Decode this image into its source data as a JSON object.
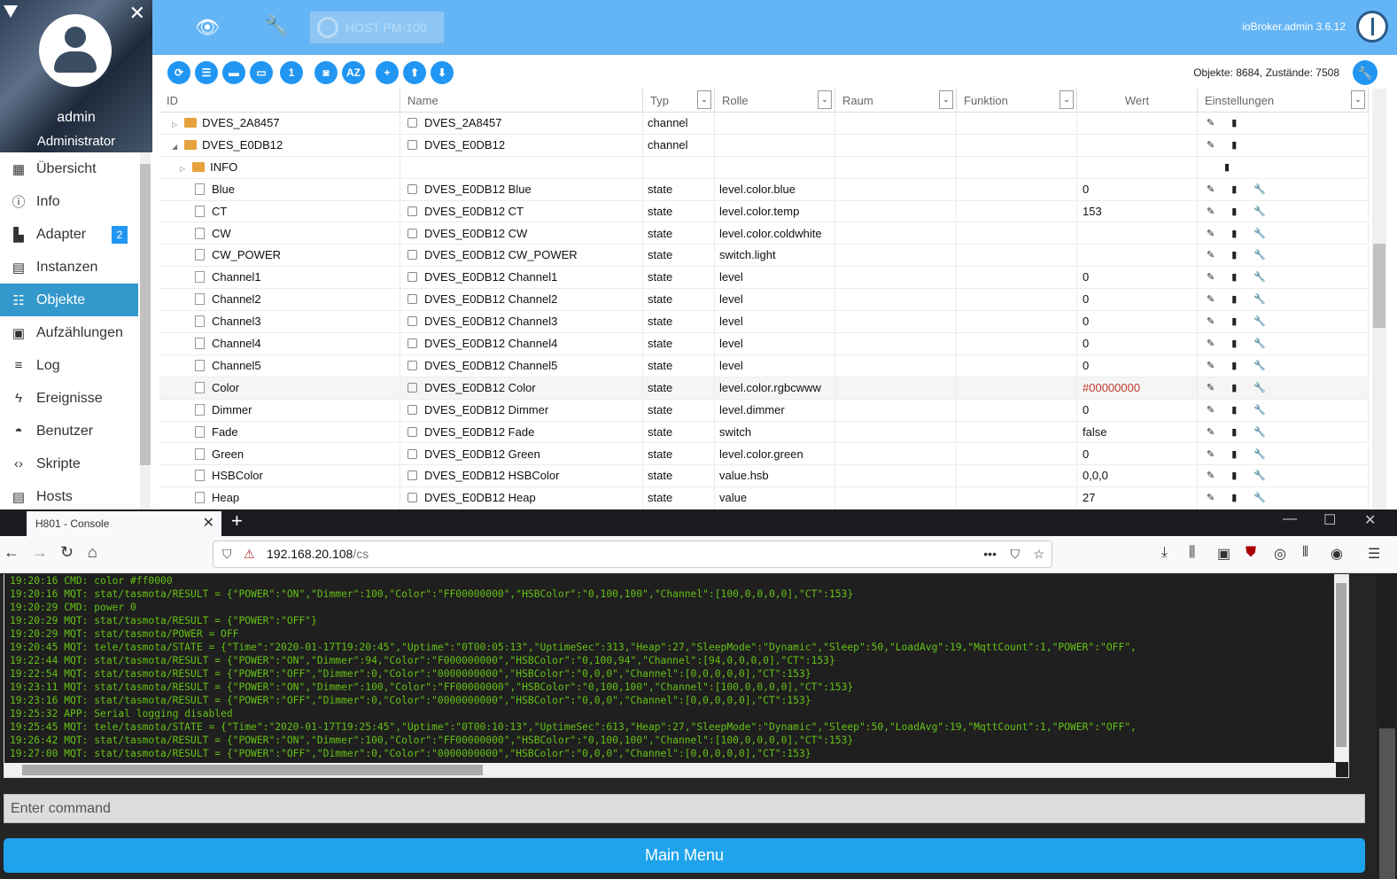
{
  "user": {
    "name": "admin",
    "role": "Administrator"
  },
  "sidebar": {
    "items": [
      {
        "label": "Übersicht",
        "icon": "grid-icon"
      },
      {
        "label": "Info",
        "icon": "info-icon"
      },
      {
        "label": "Adapter",
        "icon": "store-icon",
        "badge": "2"
      },
      {
        "label": "Instanzen",
        "icon": "instances-icon"
      },
      {
        "label": "Objekte",
        "icon": "list-icon",
        "active": true
      },
      {
        "label": "Aufzählungen",
        "icon": "enum-icon"
      },
      {
        "label": "Log",
        "icon": "log-icon"
      },
      {
        "label": "Ereignisse",
        "icon": "lightning-icon"
      },
      {
        "label": "Benutzer",
        "icon": "user-icon"
      },
      {
        "label": "Skripte",
        "icon": "code-icon"
      },
      {
        "label": "Hosts",
        "icon": "hosts-icon"
      }
    ]
  },
  "topbar": {
    "host_label": "HOST PM-100",
    "version": "ioBroker.admin 3.6.12"
  },
  "toolbar": {
    "object_count": "Objekte: 8684, Zustände: 7508"
  },
  "table": {
    "columns": [
      "ID",
      "Name",
      "Typ",
      "Rolle",
      "Raum",
      "Funktion",
      "Wert",
      "Einstellungen"
    ],
    "rows": [
      {
        "id": "DVES_2A8457",
        "kind": "folder",
        "level": 0,
        "expand": "▷",
        "name": "DVES_2A8457",
        "type": "channel",
        "role": "",
        "value": "",
        "actions": "✎ ▮"
      },
      {
        "id": "DVES_E0DB12",
        "kind": "folder",
        "level": 0,
        "expand": "◢",
        "name": "DVES_E0DB12",
        "type": "channel",
        "role": "",
        "value": "",
        "actions": "✎ ▮"
      },
      {
        "id": "INFO",
        "kind": "folder",
        "level": 1,
        "expand": "▷",
        "name": "",
        "type": "",
        "role": "",
        "value": "",
        "actions": "▮"
      },
      {
        "id": "Blue",
        "kind": "file",
        "level": 1,
        "name": "DVES_E0DB12 Blue",
        "type": "state",
        "role": "level.color.blue",
        "value": "0",
        "actions": "✎ ▮ 🔧"
      },
      {
        "id": "CT",
        "kind": "file",
        "level": 1,
        "name": "DVES_E0DB12 CT",
        "type": "state",
        "role": "level.color.temp",
        "value": "153",
        "actions": "✎ ▮ 🔧"
      },
      {
        "id": "CW",
        "kind": "file",
        "level": 1,
        "name": "DVES_E0DB12 CW",
        "type": "state",
        "role": "level.color.coldwhite",
        "value": "",
        "actions": "✎ ▮ 🔧"
      },
      {
        "id": "CW_POWER",
        "kind": "file",
        "level": 1,
        "name": "DVES_E0DB12 CW_POWER",
        "type": "state",
        "role": "switch.light",
        "value": "",
        "actions": "✎ ▮ 🔧"
      },
      {
        "id": "Channel1",
        "kind": "file",
        "level": 1,
        "name": "DVES_E0DB12 Channel1",
        "type": "state",
        "role": "level",
        "value": "0",
        "actions": "✎ ▮ 🔧"
      },
      {
        "id": "Channel2",
        "kind": "file",
        "level": 1,
        "name": "DVES_E0DB12 Channel2",
        "type": "state",
        "role": "level",
        "value": "0",
        "actions": "✎ ▮ 🔧"
      },
      {
        "id": "Channel3",
        "kind": "file",
        "level": 1,
        "name": "DVES_E0DB12 Channel3",
        "type": "state",
        "role": "level",
        "value": "0",
        "actions": "✎ ▮ 🔧"
      },
      {
        "id": "Channel4",
        "kind": "file",
        "level": 1,
        "name": "DVES_E0DB12 Channel4",
        "type": "state",
        "role": "level",
        "value": "0",
        "actions": "✎ ▮ 🔧"
      },
      {
        "id": "Channel5",
        "kind": "file",
        "level": 1,
        "name": "DVES_E0DB12 Channel5",
        "type": "state",
        "role": "level",
        "value": "0",
        "actions": "✎ ▮ 🔧"
      },
      {
        "id": "Color",
        "kind": "file",
        "level": 1,
        "name": "DVES_E0DB12 Color",
        "type": "state",
        "role": "level.color.rgbcwww",
        "value": "#00000000",
        "value_color": "#c0392b",
        "highlight": true,
        "actions": "✎ ▮ 🔧"
      },
      {
        "id": "Dimmer",
        "kind": "file",
        "level": 1,
        "name": "DVES_E0DB12 Dimmer",
        "type": "state",
        "role": "level.dimmer",
        "value": "0",
        "actions": "✎ ▮ 🔧"
      },
      {
        "id": "Fade",
        "kind": "file",
        "level": 1,
        "name": "DVES_E0DB12 Fade",
        "type": "state",
        "role": "switch",
        "value": "false",
        "actions": "✎ ▮ 🔧"
      },
      {
        "id": "Green",
        "kind": "file",
        "level": 1,
        "name": "DVES_E0DB12 Green",
        "type": "state",
        "role": "level.color.green",
        "value": "0",
        "actions": "✎ ▮ 🔧"
      },
      {
        "id": "HSBColor",
        "kind": "file",
        "level": 1,
        "name": "DVES_E0DB12 HSBColor",
        "type": "state",
        "role": "value.hsb",
        "value": "0,0,0",
        "actions": "✎ ▮ 🔧"
      },
      {
        "id": "Heap",
        "kind": "file",
        "level": 1,
        "name": "DVES_E0DB12 Heap",
        "type": "state",
        "role": "value",
        "value": "27",
        "actions": "✎ ▮ 🔧"
      }
    ]
  },
  "browser": {
    "tab_title": "H801 - Console",
    "url_host": "192.168.20.108",
    "url_path": "/cs"
  },
  "console": {
    "lines": [
      "19:20:16 CMD: color #ff0000",
      "19:20:16 MQT: stat/tasmota/RESULT = {\"POWER\":\"ON\",\"Dimmer\":100,\"Color\":\"FF00000000\",\"HSBColor\":\"0,100,100\",\"Channel\":[100,0,0,0,0],\"CT\":153}",
      "19:20:29 CMD: power 0",
      "19:20:29 MQT: stat/tasmota/RESULT = {\"POWER\":\"OFF\"}",
      "19:20:29 MQT: stat/tasmota/POWER = OFF",
      "19:20:45 MQT: tele/tasmota/STATE = {\"Time\":\"2020-01-17T19:20:45\",\"Uptime\":\"0T00:05:13\",\"UptimeSec\":313,\"Heap\":27,\"SleepMode\":\"Dynamic\",\"Sleep\":50,\"LoadAvg\":19,\"MqttCount\":1,\"POWER\":\"OFF\",",
      "19:22:44 MQT: stat/tasmota/RESULT = {\"POWER\":\"ON\",\"Dimmer\":94,\"Color\":\"F000000000\",\"HSBColor\":\"0,100,94\",\"Channel\":[94,0,0,0,0],\"CT\":153}",
      "19:22:54 MQT: stat/tasmota/RESULT = {\"POWER\":\"OFF\",\"Dimmer\":0,\"Color\":\"0000000000\",\"HSBColor\":\"0,0,0\",\"Channel\":[0,0,0,0,0],\"CT\":153}",
      "19:23:11 MQT: stat/tasmota/RESULT = {\"POWER\":\"ON\",\"Dimmer\":100,\"Color\":\"FF00000000\",\"HSBColor\":\"0,100,100\",\"Channel\":[100,0,0,0,0],\"CT\":153}",
      "19:23:16 MQT: stat/tasmota/RESULT = {\"POWER\":\"OFF\",\"Dimmer\":0,\"Color\":\"0000000000\",\"HSBColor\":\"0,0,0\",\"Channel\":[0,0,0,0,0],\"CT\":153}",
      "19:25:32 APP: Serial logging disabled",
      "19:25:45 MQT: tele/tasmota/STATE = {\"Time\":\"2020-01-17T19:25:45\",\"Uptime\":\"0T00:10:13\",\"UptimeSec\":613,\"Heap\":27,\"SleepMode\":\"Dynamic\",\"Sleep\":50,\"LoadAvg\":19,\"MqttCount\":1,\"POWER\":\"OFF\",",
      "19:26:42 MQT: stat/tasmota/RESULT = {\"POWER\":\"ON\",\"Dimmer\":100,\"Color\":\"FF00000000\",\"HSBColor\":\"0,100,100\",\"Channel\":[100,0,0,0,0],\"CT\":153}",
      "19:27:00 MQT: stat/tasmota/RESULT = {\"POWER\":\"OFF\",\"Dimmer\":0,\"Color\":\"0000000000\",\"HSBColor\":\"0,0,0\",\"Channel\":[0,0,0,0,0],\"CT\":153}"
    ],
    "command_placeholder": "Enter command",
    "main_menu_label": "Main Menu"
  },
  "colors": {
    "accent": "#2196f3",
    "topbar": "#64b5f6",
    "console_text": "#65c115",
    "button": "#1fa3ec"
  }
}
